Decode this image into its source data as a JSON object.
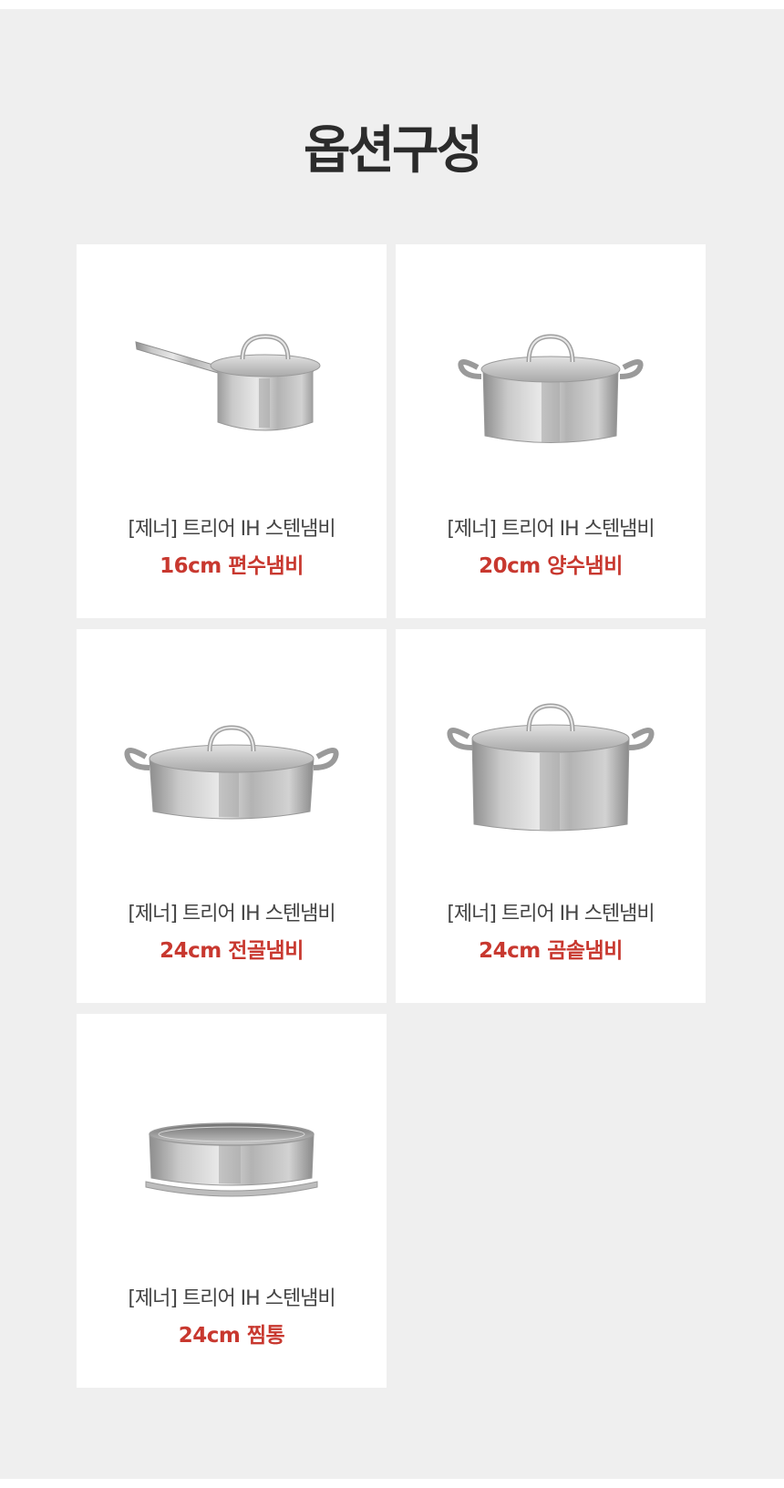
{
  "header": {
    "title": "옵션구성"
  },
  "colors": {
    "background": "#efefef",
    "card": "#ffffff",
    "accent": "#c8382f",
    "text": "#444444"
  },
  "options": [
    {
      "brand": "[제너] 트리어 IH 스텐냄비",
      "model": "16cm 편수냄비",
      "icon": "saucepan-icon"
    },
    {
      "brand": "[제너] 트리어 IH 스텐냄비",
      "model": "20cm 양수냄비",
      "icon": "two-handle-pot-icon"
    },
    {
      "brand": "[제너] 트리어 IH 스텐냄비",
      "model": "24cm 전골냄비",
      "icon": "shallow-casserole-icon"
    },
    {
      "brand": "[제너] 트리어 IH 스텐냄비",
      "model": "24cm 곰솥냄비",
      "icon": "stockpot-icon"
    },
    {
      "brand": "[제너] 트리어 IH 스텐냄비",
      "model": "24cm 찜통",
      "icon": "steamer-insert-icon"
    }
  ]
}
